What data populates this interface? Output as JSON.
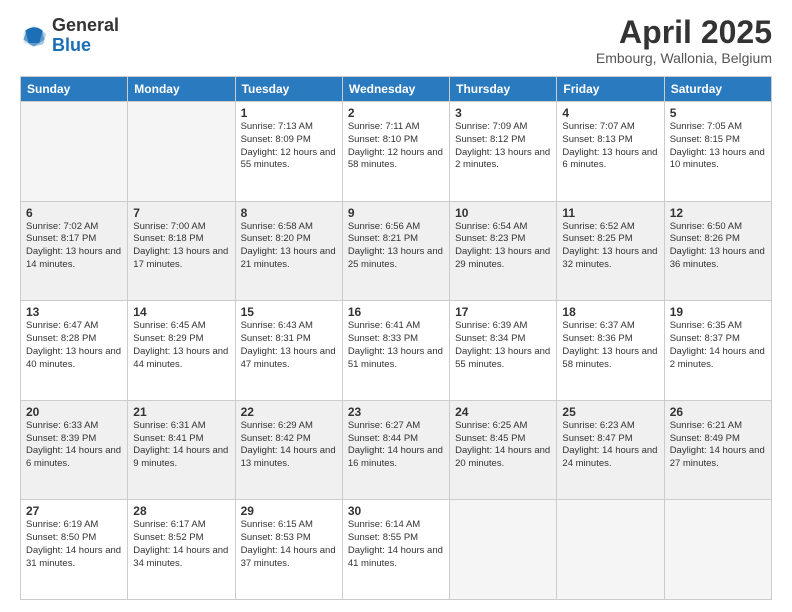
{
  "logo": {
    "line1": "General",
    "line2": "Blue"
  },
  "title": "April 2025",
  "subtitle": "Embourg, Wallonia, Belgium",
  "days_of_week": [
    "Sunday",
    "Monday",
    "Tuesday",
    "Wednesday",
    "Thursday",
    "Friday",
    "Saturday"
  ],
  "weeks": [
    [
      {
        "day": "",
        "info": ""
      },
      {
        "day": "",
        "info": ""
      },
      {
        "day": "1",
        "info": "Sunrise: 7:13 AM\nSunset: 8:09 PM\nDaylight: 12 hours and 55 minutes."
      },
      {
        "day": "2",
        "info": "Sunrise: 7:11 AM\nSunset: 8:10 PM\nDaylight: 12 hours and 58 minutes."
      },
      {
        "day": "3",
        "info": "Sunrise: 7:09 AM\nSunset: 8:12 PM\nDaylight: 13 hours and 2 minutes."
      },
      {
        "day": "4",
        "info": "Sunrise: 7:07 AM\nSunset: 8:13 PM\nDaylight: 13 hours and 6 minutes."
      },
      {
        "day": "5",
        "info": "Sunrise: 7:05 AM\nSunset: 8:15 PM\nDaylight: 13 hours and 10 minutes."
      }
    ],
    [
      {
        "day": "6",
        "info": "Sunrise: 7:02 AM\nSunset: 8:17 PM\nDaylight: 13 hours and 14 minutes."
      },
      {
        "day": "7",
        "info": "Sunrise: 7:00 AM\nSunset: 8:18 PM\nDaylight: 13 hours and 17 minutes."
      },
      {
        "day": "8",
        "info": "Sunrise: 6:58 AM\nSunset: 8:20 PM\nDaylight: 13 hours and 21 minutes."
      },
      {
        "day": "9",
        "info": "Sunrise: 6:56 AM\nSunset: 8:21 PM\nDaylight: 13 hours and 25 minutes."
      },
      {
        "day": "10",
        "info": "Sunrise: 6:54 AM\nSunset: 8:23 PM\nDaylight: 13 hours and 29 minutes."
      },
      {
        "day": "11",
        "info": "Sunrise: 6:52 AM\nSunset: 8:25 PM\nDaylight: 13 hours and 32 minutes."
      },
      {
        "day": "12",
        "info": "Sunrise: 6:50 AM\nSunset: 8:26 PM\nDaylight: 13 hours and 36 minutes."
      }
    ],
    [
      {
        "day": "13",
        "info": "Sunrise: 6:47 AM\nSunset: 8:28 PM\nDaylight: 13 hours and 40 minutes."
      },
      {
        "day": "14",
        "info": "Sunrise: 6:45 AM\nSunset: 8:29 PM\nDaylight: 13 hours and 44 minutes."
      },
      {
        "day": "15",
        "info": "Sunrise: 6:43 AM\nSunset: 8:31 PM\nDaylight: 13 hours and 47 minutes."
      },
      {
        "day": "16",
        "info": "Sunrise: 6:41 AM\nSunset: 8:33 PM\nDaylight: 13 hours and 51 minutes."
      },
      {
        "day": "17",
        "info": "Sunrise: 6:39 AM\nSunset: 8:34 PM\nDaylight: 13 hours and 55 minutes."
      },
      {
        "day": "18",
        "info": "Sunrise: 6:37 AM\nSunset: 8:36 PM\nDaylight: 13 hours and 58 minutes."
      },
      {
        "day": "19",
        "info": "Sunrise: 6:35 AM\nSunset: 8:37 PM\nDaylight: 14 hours and 2 minutes."
      }
    ],
    [
      {
        "day": "20",
        "info": "Sunrise: 6:33 AM\nSunset: 8:39 PM\nDaylight: 14 hours and 6 minutes."
      },
      {
        "day": "21",
        "info": "Sunrise: 6:31 AM\nSunset: 8:41 PM\nDaylight: 14 hours and 9 minutes."
      },
      {
        "day": "22",
        "info": "Sunrise: 6:29 AM\nSunset: 8:42 PM\nDaylight: 14 hours and 13 minutes."
      },
      {
        "day": "23",
        "info": "Sunrise: 6:27 AM\nSunset: 8:44 PM\nDaylight: 14 hours and 16 minutes."
      },
      {
        "day": "24",
        "info": "Sunrise: 6:25 AM\nSunset: 8:45 PM\nDaylight: 14 hours and 20 minutes."
      },
      {
        "day": "25",
        "info": "Sunrise: 6:23 AM\nSunset: 8:47 PM\nDaylight: 14 hours and 24 minutes."
      },
      {
        "day": "26",
        "info": "Sunrise: 6:21 AM\nSunset: 8:49 PM\nDaylight: 14 hours and 27 minutes."
      }
    ],
    [
      {
        "day": "27",
        "info": "Sunrise: 6:19 AM\nSunset: 8:50 PM\nDaylight: 14 hours and 31 minutes."
      },
      {
        "day": "28",
        "info": "Sunrise: 6:17 AM\nSunset: 8:52 PM\nDaylight: 14 hours and 34 minutes."
      },
      {
        "day": "29",
        "info": "Sunrise: 6:15 AM\nSunset: 8:53 PM\nDaylight: 14 hours and 37 minutes."
      },
      {
        "day": "30",
        "info": "Sunrise: 6:14 AM\nSunset: 8:55 PM\nDaylight: 14 hours and 41 minutes."
      },
      {
        "day": "",
        "info": ""
      },
      {
        "day": "",
        "info": ""
      },
      {
        "day": "",
        "info": ""
      }
    ]
  ]
}
